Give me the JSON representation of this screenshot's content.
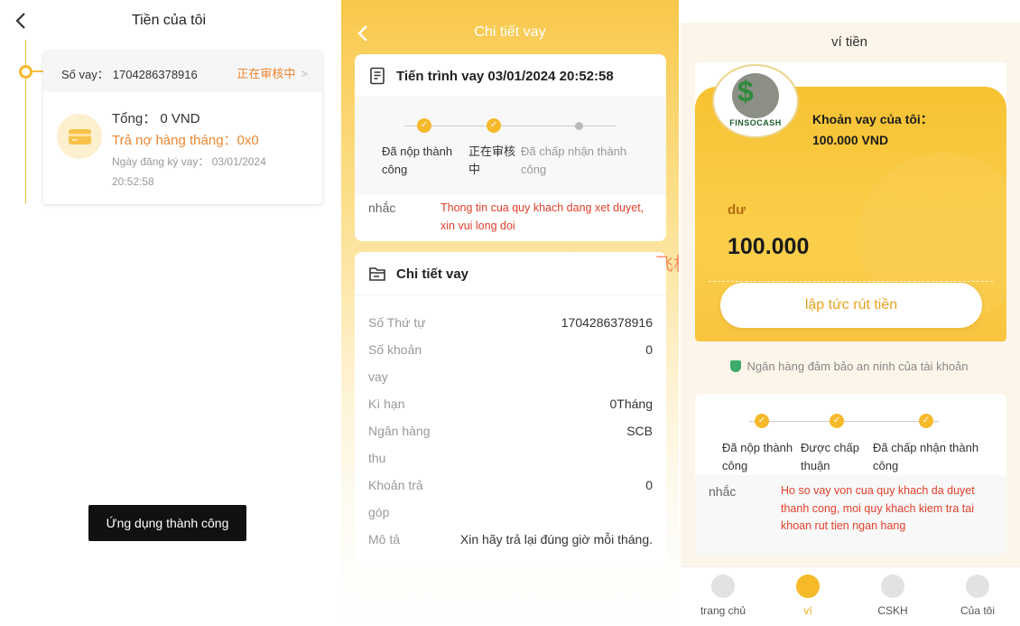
{
  "left": {
    "title": "Tiền của tôi",
    "loan_no_label": "Số vay：",
    "loan_no": "1704286378916",
    "status": "正在审核中",
    "total": "Tổng： 0 VND",
    "monthly": "Trả nợ hàng tháng：0x0",
    "reg_date": "Ngày đăng ký vay： 03/01/2024 20:52:58",
    "toast": "Ứng dụng thành công"
  },
  "middle": {
    "title": "Chi tiết vay",
    "progress_title": "Tiến trình vay 03/01/2024 20:52:58",
    "steps": [
      "Đã nộp thành công",
      "正在审核中",
      "Đã chấp nhận thành công"
    ],
    "remind_label": "nhắc",
    "remind_text": "Thong tin cua quy khach dang xet duyet, xin vui long doi",
    "detail_title": "Chi tiết vay",
    "rows": [
      {
        "k": "Số Thứ tự",
        "v": "1704286378916"
      },
      {
        "k": "Số khoản vay",
        "v": "0"
      },
      {
        "k": "Kì hạn",
        "v": "0Tháng"
      },
      {
        "k": "Ngân hàng thu",
        "v": "SCB"
      },
      {
        "k": "Khoản trả góp",
        "v": "0"
      },
      {
        "k": "Mô tả",
        "v": "Xin hãy trả lại đúng giờ mỗi tháng."
      }
    ],
    "watermark": "飞机：@"
  },
  "right": {
    "title": "ví tiền",
    "logo_text": "FINSOCASH",
    "loan_label": "Khoản vay của tôi：",
    "loan_amount": "100.000 VND",
    "balance_label": "dư",
    "balance": "100.000",
    "withdraw": "lập tức rút tiền",
    "secure": "Ngân hàng đảm bảo an ninh của tài khoản",
    "steps": [
      "Đã nộp thành công",
      "Được chấp thuận",
      "Đã chấp nhận thành công"
    ],
    "remind_label": "nhắc",
    "remind_text": "Ho so vay von cua quy khach da duyet thanh cong, moi quy khach kiem tra tai khoan rut tien ngan hang",
    "nav": [
      {
        "label": "trang chủ",
        "icon": "home-icon"
      },
      {
        "label": "ví",
        "icon": "wallet-icon"
      },
      {
        "label": "CSKH",
        "icon": "support-icon"
      },
      {
        "label": "Của tôi",
        "icon": "user-icon"
      }
    ]
  },
  "colors": {
    "accent": "#f5b92a",
    "status": "#ee8630",
    "alert": "#e0402c"
  }
}
